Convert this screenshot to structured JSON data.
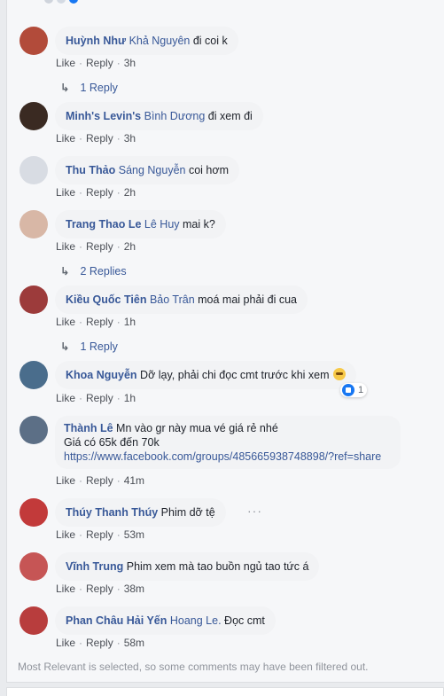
{
  "comments": [
    {
      "author": "Huỳnh Như",
      "tag": "Khả Nguyên",
      "text": " đi coi k",
      "like": "Like",
      "reply": "Reply",
      "time": "3h",
      "replies": "1 Reply",
      "avatar_color": "#b24b3a"
    },
    {
      "author": "Minh's Levin's",
      "tag": "Bình Dương",
      "text": " đi xem đi",
      "like": "Like",
      "reply": "Reply",
      "time": "3h",
      "avatar_color": "#3a2a22"
    },
    {
      "author": "Thu Thảo",
      "tag": "Sáng Nguyễn",
      "text": " coi hơm",
      "like": "Like",
      "reply": "Reply",
      "time": "2h",
      "avatar_color": "#d8dce3"
    },
    {
      "author": "Trang Thao Le",
      "tag": "Lê Huy",
      "text": " mai k?",
      "like": "Like",
      "reply": "Reply",
      "time": "2h",
      "replies": "2 Replies",
      "avatar_color": "#d8b7a6"
    },
    {
      "author": "Kiều Quốc Tiên",
      "tag": "Bảo Trân",
      "text": " moá mai phải đi cua",
      "like": "Like",
      "reply": "Reply",
      "time": "1h",
      "replies": "1 Reply",
      "avatar_color": "#9c3b3b"
    },
    {
      "author": "Khoa Nguyễn",
      "tag": "",
      "text": "Dỡ lạy, phải chi đọc cmt trước khi xem",
      "like": "Like",
      "reply": "Reply",
      "time": "1h",
      "reaction_count": "1",
      "avatar_color": "#4a6d8c"
    },
    {
      "author": "Thành Lê",
      "tag": "",
      "text": "Mn vào gr này mua vé giá rẻ nhé",
      "line2": "Giá có 65k đến 70k",
      "link": "https://www.facebook.com/groups/485665938748898/?ref=share",
      "like": "Like",
      "reply": "Reply",
      "time": "41m",
      "avatar_color": "#5c6f86"
    },
    {
      "author": "Thúy Thanh Thúy",
      "tag": "",
      "text": "Phim dỡ tệ",
      "like": "Like",
      "reply": "Reply",
      "time": "53m",
      "more": "···",
      "avatar_color": "#c23a3a"
    },
    {
      "author": "Vĩnh Trung",
      "tag": "",
      "text": "Phim xem mà tao buồn ngủ tao tức á",
      "like": "Like",
      "reply": "Reply",
      "time": "38m",
      "avatar_color": "#c65555"
    },
    {
      "author": "Phan Châu Hải Yến",
      "tag": "Hoang Le.",
      "text": " Đọc cmt",
      "like": "Like",
      "reply": "Reply",
      "time": "58m",
      "avatar_color": "#b83d3d"
    }
  ],
  "footer_note": "Most Relevant is selected, so some comments may have been filtered out.",
  "sep": "·"
}
